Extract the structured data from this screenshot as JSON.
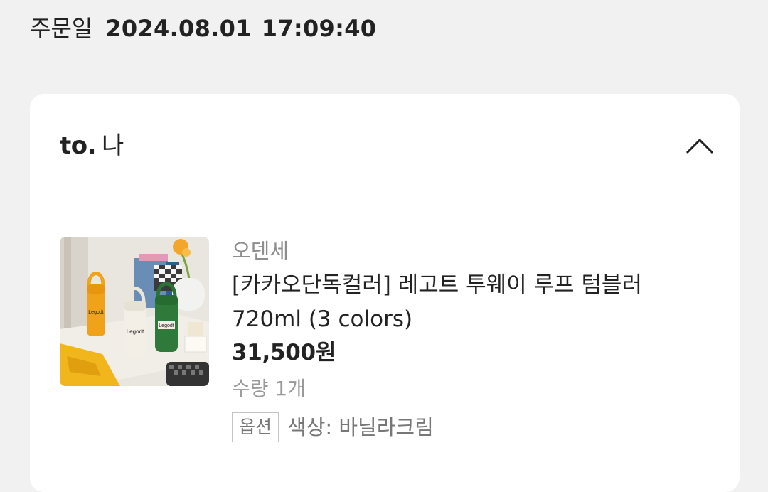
{
  "order": {
    "date_label": "주문일",
    "date": "2024.08.01",
    "time": "17:09:40"
  },
  "recipient": {
    "prefix": "to.",
    "name": "나"
  },
  "product": {
    "brand": "오덴세",
    "title_line1": "[카카오단독컬러] 레고트 투웨이 루프 텀블러",
    "title_line2": "720ml (3 colors)",
    "price": "31,500",
    "currency": "원",
    "quantity": "수량 1개",
    "option_badge": "옵션",
    "option_value": "색상: 바닐라크림",
    "image_label": "Legodt"
  },
  "icons": {
    "collapse": "chevron-up-icon"
  }
}
